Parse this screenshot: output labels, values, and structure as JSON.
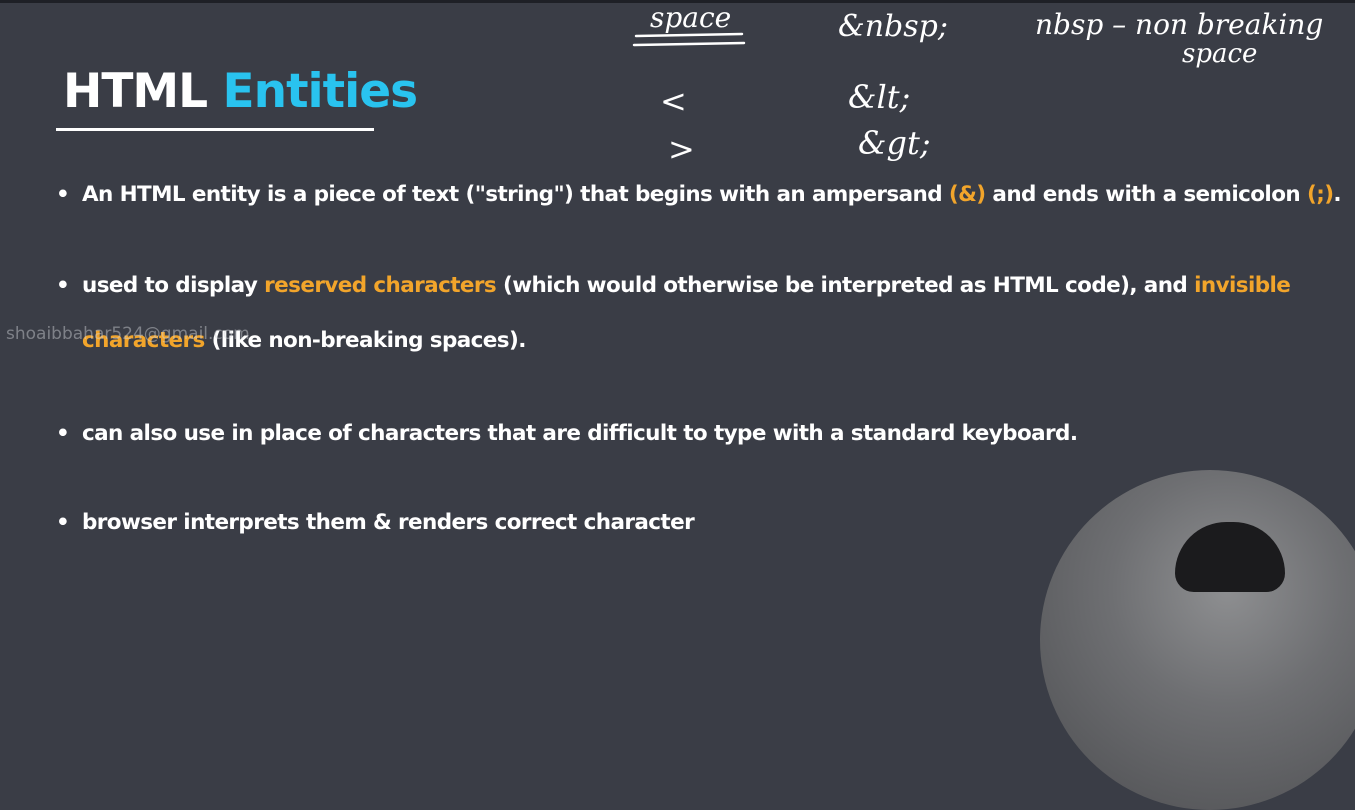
{
  "slide": {
    "title_part1": "HTML",
    "title_part2": "Entities",
    "title_colors": {
      "white": "#ffffff",
      "accent": "#29c3ef"
    },
    "highlight_color": "#f2a52b",
    "background_color": "#3a3d46"
  },
  "bullets": [
    {
      "text_a": "An HTML entity is a piece of text (\"string\") that begins with an ampersand ",
      "hl_a": "(&)",
      "text_b": " and ends with a semicolon ",
      "hl_b": "(;)",
      "text_c": "."
    },
    {
      "text_a": "used to display ",
      "hl_a": "reserved characters",
      "text_b": " (which would otherwise be interpreted as HTML code), and ",
      "hl_b": "invisible",
      "line2_hl": "characters",
      "line2_text": " (like non-breaking spaces)."
    },
    {
      "text_a": "can also use in place of characters that are difficult to type with a standard keyboard."
    },
    {
      "text_a": "browser interprets them & renders correct character"
    }
  ],
  "bullet_glyph": "•",
  "watermark": "shoaibbahar524@gmail.com",
  "annotations": {
    "row1_symbol": "space",
    "row1_entity": "&nbsp;",
    "row1_note": "nbsp – non breaking",
    "row1_note_line2": "space",
    "row2_symbol": "<",
    "row2_entity": "&lt;",
    "row3_symbol": ">",
    "row3_entity": "&gt;"
  }
}
